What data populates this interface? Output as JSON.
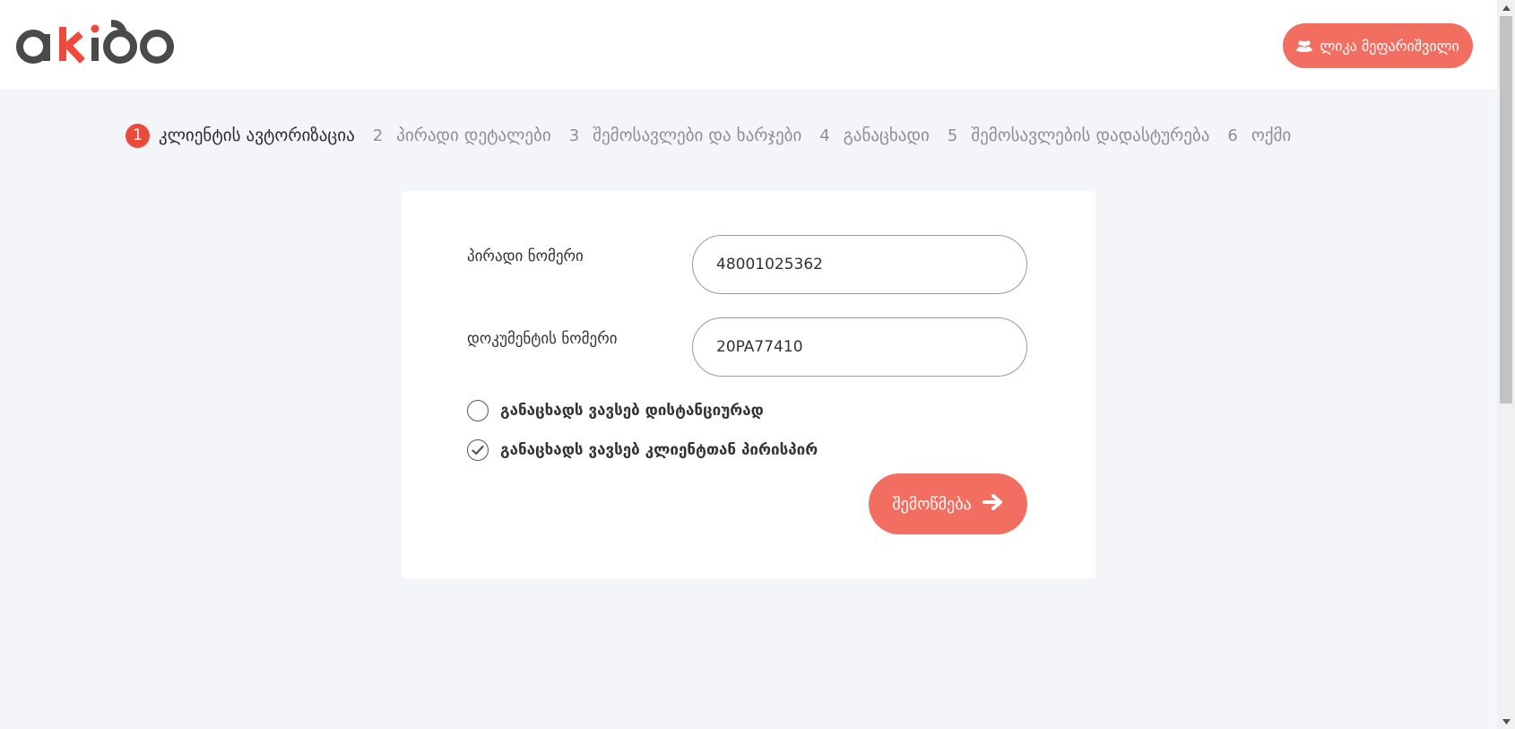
{
  "header": {
    "logo_text": "akido",
    "user_name": "ლიკა მეფარიშვილი",
    "user_icon": "users-icon"
  },
  "steps": [
    {
      "number": "1",
      "label": "კლიენტის ავტორიზაცია",
      "active": true
    },
    {
      "number": "2",
      "label": "პირადი დეტალები",
      "active": false
    },
    {
      "number": "3",
      "label": "შემოსავლები და ხარჯები",
      "active": false
    },
    {
      "number": "4",
      "label": "განაცხადი",
      "active": false
    },
    {
      "number": "5",
      "label": "შემოსავლების დადასტურება",
      "active": false
    },
    {
      "number": "6",
      "label": "ოქმი",
      "active": false
    }
  ],
  "form": {
    "personal_number_label": "პირადი ნომერი",
    "personal_number_value": "48001025362",
    "document_number_label": "დოკუმენტის ნომერი",
    "document_number_value": "20PA77410",
    "option_remote_label": "განაცხადს ვავსებ დისტანციურად",
    "option_remote_selected": false,
    "option_in_person_label": "განაცხადს ვავსებ კლიენტთან პირისპირ",
    "option_in_person_selected": true,
    "submit_label": "შემოწმება",
    "submit_icon": "arrow-right-icon"
  },
  "colors": {
    "accent": "#f26e61",
    "active_step": "#ea4b3c",
    "logo_dark": "#4a4a4a",
    "logo_red": "#f0483a",
    "background": "#f4f5f8"
  }
}
